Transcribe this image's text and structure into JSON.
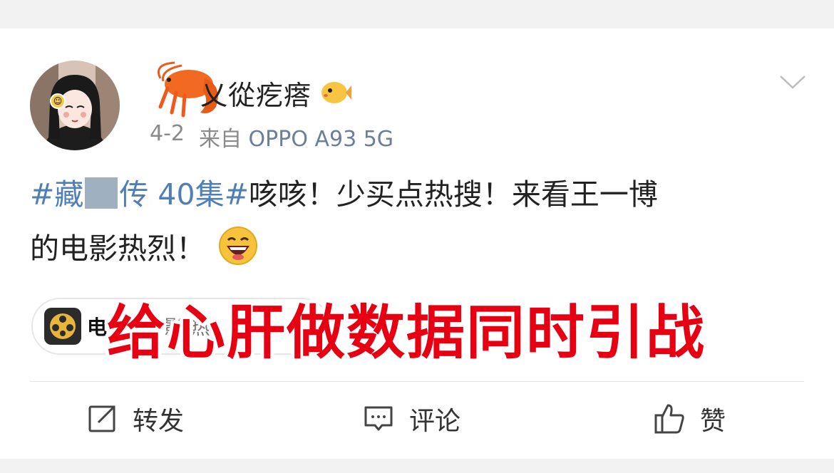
{
  "post": {
    "username": "乂從疙瘩",
    "date": "4-2",
    "source_prefix": "来自",
    "device": "OPPO A93 5G",
    "text": {
      "topic_part1": "#藏",
      "topic_part2": "传 40集#",
      "body_line1": "咳咳！少买点热搜！来看王一博",
      "body_line2": "的电影热烈！"
    },
    "chip": {
      "label": "电",
      "extra": "影 热"
    },
    "overlay_caption": "给心肝做数据同时引战"
  },
  "actions": {
    "repost": "转发",
    "comment": "评论",
    "like": "赞"
  },
  "icons": {
    "avatar_badge": "smile-badge-icon",
    "shrimp": "shrimp-sticker",
    "fish": "puffer-fish-icon",
    "menu": "chevron-down-icon",
    "emoji": "laughing-emoji",
    "chip": "film-reel-icon",
    "repost": "repost-icon",
    "comment": "comment-icon",
    "like": "thumbs-up-icon"
  },
  "colors": {
    "topic": "#4f7fb6",
    "overlay": "#e60012",
    "meta": "#8a8a8a"
  }
}
